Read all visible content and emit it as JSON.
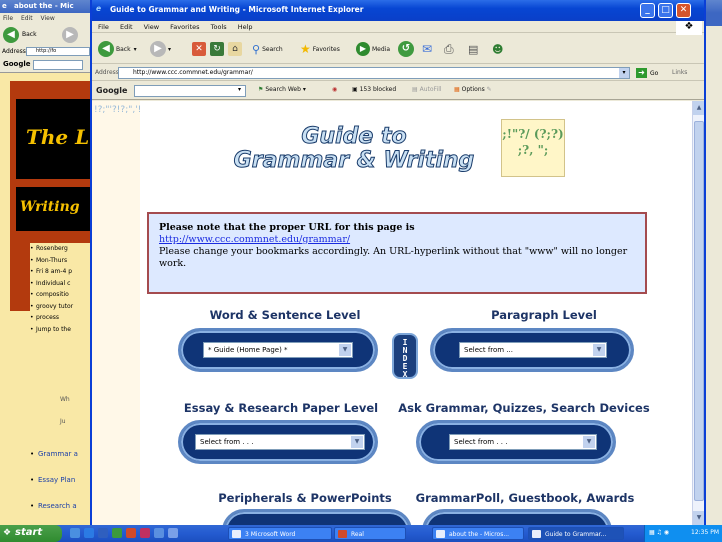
{
  "bg_window": {
    "title": "about the - Mic",
    "menu": [
      "File",
      "Edit",
      "View"
    ],
    "back_label": "Back",
    "address_label": "Address",
    "address_value": "http://fo",
    "google_label": "Google",
    "banner_top": "The L",
    "banner_bottom": "Writing",
    "bullets": [
      "Rosenberg",
      "Mon-Thurs",
      "Fri 8 am-4 p",
      "Individual c",
      "compositio",
      "groovy tutor",
      "process",
      "Jump to the"
    ],
    "notes": [
      "Wh",
      "Ju"
    ],
    "bottom_links": [
      "Grammar a",
      "Essay Plan",
      "Research a"
    ]
  },
  "window": {
    "title": "Guide to Grammar and Writing - Microsoft Internet Explorer",
    "menu": [
      "File",
      "Edit",
      "View",
      "Favorites",
      "Tools",
      "Help"
    ]
  },
  "toolbar": {
    "back_label": "Back",
    "search_label": "Search",
    "favorites_label": "Favorites",
    "media_label": "Media"
  },
  "address_bar": {
    "label": "Address",
    "url": "http://www.ccc.commnet.edu/grammar/",
    "go_label": "Go",
    "links_label": "Links"
  },
  "google_bar": {
    "logo": "Google",
    "search_web": "Search Web",
    "blocked": "153 blocked",
    "autofill": "AutoFill",
    "options": "Options"
  },
  "page": {
    "left_pattern": "!?;\"'?!?;\",'!?\"?;'!?\";'?!,\"?;'!?\";'?!,\"?;'!?\";'?!\"?;'!?\";,'?!?\"?;!?\"';?!,\"?;'!?\";'?!\"?;'!?\";,'?!?\"?;!?\"';?!,\"?;'!?\";'?!\"?;'!?\";,'?!?\"?;!?\"';?!,\"?;'!?\";'?!\"?;",
    "header_title_1": "Guide to",
    "header_title_2": "Grammar & Writing",
    "header_punct": ";!\"?/ (?;?) ;?, \";",
    "notice_bold": "Please note that the proper URL for this page is",
    "notice_url": "http://www.ccc.commnet.edu/grammar/",
    "notice_text": "Please change your bookmarks accordingly. An URL-hyperlink without that \"www\" will no longer work.",
    "sections": {
      "word_sentence": "Word & Sentence Level",
      "paragraph": "Paragraph Level",
      "essay": "Essay & Research Paper Level",
      "ask": "Ask Grammar, Quizzes, Search Devices",
      "peripherals": "Peripherals & PowerPoints",
      "poll": "GrammarPoll, Guestbook, Awards"
    },
    "selects": {
      "word_sentence": "* Guide (Home Page) *",
      "paragraph": "Select from ...",
      "essay": "Select from . . .",
      "ask": "Select from . . ."
    },
    "index_letters": [
      "I",
      "N",
      "D",
      "E",
      "X"
    ]
  },
  "taskbar": {
    "start_label": "start",
    "tasks": [
      {
        "label": "3 Microsoft Word",
        "active": false
      },
      {
        "label": "Real",
        "active": false
      },
      {
        "label": "about the - Micros...",
        "active": false
      },
      {
        "label": "Guide to Grammar...",
        "active": true
      }
    ],
    "clock": "12:35 PM"
  },
  "colors": {
    "xp_blue": "#0a3fc8",
    "pill_blue": "#0f3477",
    "notice_bg": "#dde9ff",
    "notice_border": "#a44b4f",
    "section_text": "#1d3466"
  }
}
